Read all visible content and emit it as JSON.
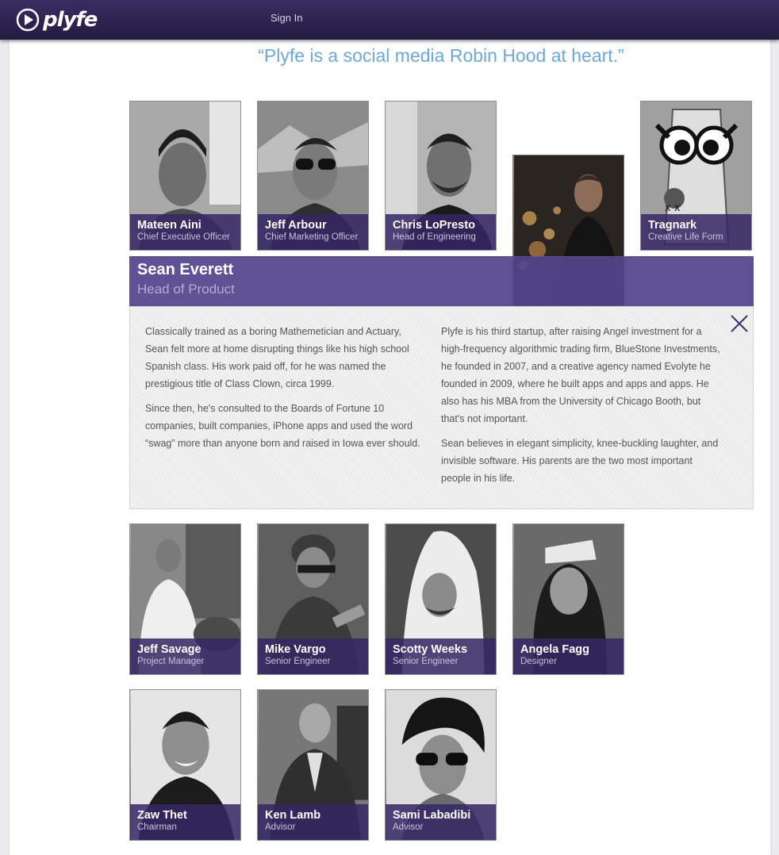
{
  "nav": {
    "logo_text": "plyfe",
    "signin_label": "Sign In"
  },
  "quote": "“Plyfe is a social media Robin Hood at heart.”",
  "team_row1": [
    {
      "name": "Mateen Aini",
      "role": "Chief Executive Officer"
    },
    {
      "name": "Jeff Arbour",
      "role": "Chief Marketing Officer"
    },
    {
      "name": "Chris LoPresto",
      "role": "Head of Engineering"
    },
    {
      "name": "Sean Everett",
      "role": "Head of Product"
    },
    {
      "name": "Tragnark",
      "role": "Creative Life Form"
    }
  ],
  "detail": {
    "name": "Sean Everett",
    "role": "Head of Product",
    "left_paragraphs": [
      "Classically trained as a boring Mathemetician and Actuary, Sean felt more at home disrupting things like his high school Spanish class. His work paid off, for he was named the prestigious title of Class Clown, circa 1999.",
      "Since then, he's consulted to the Boards of Fortune 10 companies, built companies, iPhone apps and used the word “swag” more than anyone born and raised in Iowa ever should."
    ],
    "right_paragraphs": [
      "Plyfe is his third startup, after raising Angel investment for a high-frequency algorithmic trading firm, BlueStone Investments, he founded in 2007, and a creative agency named Evolyte he founded in 2009, where he built apps and apps and apps. He also has his MBA from the University of Chicago Booth, but that's not important.",
      "Sean believes in elegant simplicity, knee-buckling laughter, and invisible software. His parents are the two most important people in his life."
    ]
  },
  "team_row2": [
    {
      "name": "Jeff Savage",
      "role": "Project Manager"
    },
    {
      "name": "Mike Vargo",
      "role": "Senior Engineer"
    },
    {
      "name": "Scotty Weeks",
      "role": "Senior Engineer"
    },
    {
      "name": "Angela Fagg",
      "role": "Designer"
    }
  ],
  "team_row3": [
    {
      "name": "Zaw Thet",
      "role": "Chairman"
    },
    {
      "name": "Ken Lamb",
      "role": "Advisor"
    },
    {
      "name": "Sami Labadibi",
      "role": "Advisor"
    }
  ],
  "colors": {
    "nav_bg": "#2c2250",
    "accent_purple": "#342664",
    "quote_blue": "#6fa8d8"
  },
  "icons": {
    "logo": "play-circle-icon",
    "close": "close-x-icon"
  }
}
